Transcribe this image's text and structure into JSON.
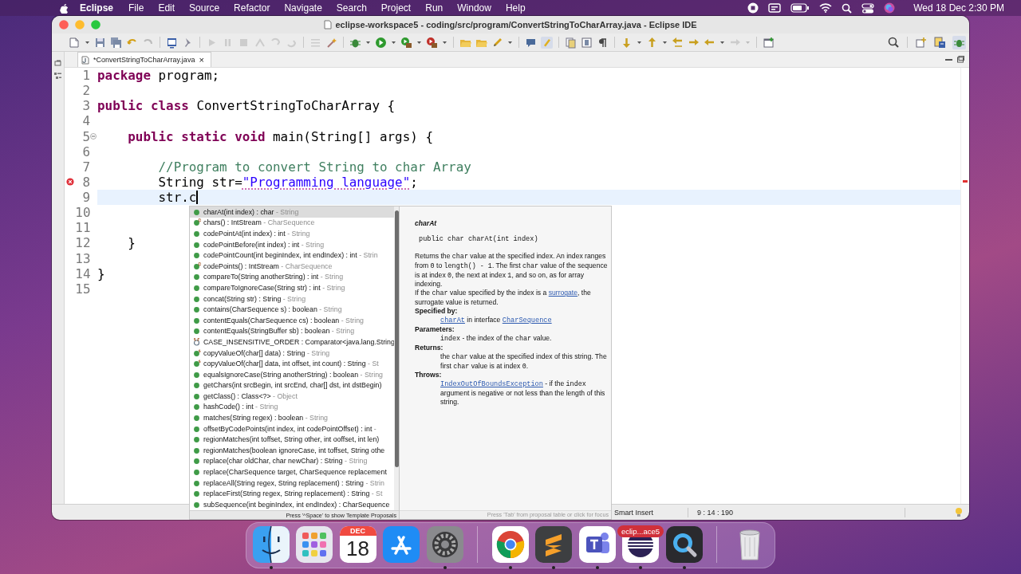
{
  "menubar": {
    "app": "Eclipse",
    "items": [
      "File",
      "Edit",
      "Source",
      "Refactor",
      "Navigate",
      "Search",
      "Project",
      "Run",
      "Window",
      "Help"
    ],
    "clock": "Wed 18 Dec  2:30 PM"
  },
  "window": {
    "title": "eclipse-workspace5 - coding/src/program/ConvertStringToCharArray.java - Eclipse IDE"
  },
  "editor_tab": {
    "label": "*ConvertStringToCharArray.java",
    "close": "×"
  },
  "code_lines": [
    {
      "number": "1",
      "current": false,
      "error": false,
      "foldable": false,
      "tokens": [
        {
          "kind": "keyword",
          "text": "package"
        },
        {
          "kind": "plain",
          "text": " program;"
        }
      ]
    },
    {
      "number": "2",
      "current": false,
      "error": false,
      "foldable": false
    },
    {
      "number": "3",
      "current": false,
      "error": false,
      "foldable": false,
      "tokens": [
        {
          "kind": "keyword",
          "text": "public class"
        },
        {
          "kind": "plain",
          "text": " ConvertStringToCharArray {"
        }
      ]
    },
    {
      "number": "4",
      "current": false,
      "error": false,
      "foldable": false
    },
    {
      "number": "5",
      "current": false,
      "error": false,
      "foldable": true,
      "tokens": [
        {
          "kind": "keyword",
          "text": "    public static void"
        },
        {
          "kind": "plain",
          "text": " main(String[] args) {"
        }
      ]
    },
    {
      "number": "6",
      "current": false,
      "error": false,
      "foldable": false
    },
    {
      "number": "7",
      "current": false,
      "error": false,
      "foldable": false,
      "tokens": [
        {
          "kind": "comment",
          "text": "        //Program to convert String to char Array"
        }
      ]
    },
    {
      "number": "8",
      "current": false,
      "error": true,
      "foldable": false,
      "tokens": [
        {
          "kind": "plain",
          "text": "        String str="
        },
        {
          "kind": "flagged-string",
          "text": "\"Programming language\""
        },
        {
          "kind": "plain",
          "text": ";"
        }
      ]
    },
    {
      "number": "9",
      "current": true,
      "error": false,
      "foldable": false,
      "tokens": [
        {
          "kind": "plain",
          "text": "        str.c"
        }
      ]
    },
    {
      "number": "10",
      "current": false,
      "error": false,
      "foldable": false
    },
    {
      "number": "11",
      "current": false,
      "error": false,
      "foldable": false
    },
    {
      "number": "12",
      "current": false,
      "error": false,
      "foldable": false,
      "tokens": [
        {
          "kind": "plain",
          "text": "    }"
        }
      ]
    },
    {
      "number": "13",
      "current": false,
      "error": false,
      "foldable": false
    },
    {
      "number": "14",
      "current": false,
      "error": false,
      "foldable": false,
      "tokens": [
        {
          "kind": "plain",
          "text": "}"
        }
      ]
    },
    {
      "number": "15",
      "current": false,
      "error": false,
      "foldable": false
    }
  ],
  "proposals": [
    {
      "kind": "method",
      "selected": true,
      "text": "charAt(int index) : char",
      "qualifier": "- String"
    },
    {
      "kind": "default-method",
      "selected": false,
      "text": "chars() : IntStream",
      "qualifier": "- CharSequence"
    },
    {
      "kind": "method",
      "selected": false,
      "text": "codePointAt(int index) : int",
      "qualifier": "- String"
    },
    {
      "kind": "method",
      "selected": false,
      "text": "codePointBefore(int index) : int",
      "qualifier": "- String"
    },
    {
      "kind": "method",
      "selected": false,
      "text": "codePointCount(int beginIndex, int endIndex) : int",
      "qualifier": "- Strin"
    },
    {
      "kind": "default-method",
      "selected": false,
      "text": "codePoints() : IntStream",
      "qualifier": "- CharSequence"
    },
    {
      "kind": "method",
      "selected": false,
      "text": "compareTo(String anotherString) : int",
      "qualifier": "- String"
    },
    {
      "kind": "method",
      "selected": false,
      "text": "compareToIgnoreCase(String str) : int",
      "qualifier": "- String"
    },
    {
      "kind": "method",
      "selected": false,
      "text": "concat(String str) : String",
      "qualifier": "- String"
    },
    {
      "kind": "method",
      "selected": false,
      "text": "contains(CharSequence s) : boolean",
      "qualifier": "- String"
    },
    {
      "kind": "method",
      "selected": false,
      "text": "contentEquals(CharSequence cs) : boolean",
      "qualifier": "- String"
    },
    {
      "kind": "method",
      "selected": false,
      "text": "contentEquals(StringBuffer sb) : boolean",
      "qualifier": "- String"
    },
    {
      "kind": "static-field",
      "selected": false,
      "text": "CASE_INSENSITIVE_ORDER : Comparator<java.lang.String"
    },
    {
      "kind": "static-method",
      "selected": false,
      "text": "copyValueOf(char[] data) : String",
      "qualifier": "- String"
    },
    {
      "kind": "static-method",
      "selected": false,
      "text": "copyValueOf(char[] data, int offset, int count) : String",
      "qualifier": "- St"
    },
    {
      "kind": "method",
      "selected": false,
      "text": "equalsIgnoreCase(String anotherString) : boolean",
      "qualifier": "- String"
    },
    {
      "kind": "method",
      "selected": false,
      "text": "getChars(int srcBegin, int srcEnd, char[] dst, int dstBegin)"
    },
    {
      "kind": "method",
      "selected": false,
      "text": "getClass() : Class<?>",
      "qualifier": "- Object"
    },
    {
      "kind": "method",
      "selected": false,
      "text": "hashCode() : int",
      "qualifier": "- String"
    },
    {
      "kind": "method",
      "selected": false,
      "text": "matches(String regex) : boolean",
      "qualifier": "- String"
    },
    {
      "kind": "method",
      "selected": false,
      "text": "offsetByCodePoints(int index, int codePointOffset) : int",
      "qualifier": "-"
    },
    {
      "kind": "method",
      "selected": false,
      "text": "regionMatches(int toffset, String other, int ooffset, int len)"
    },
    {
      "kind": "method",
      "selected": false,
      "text": "regionMatches(boolean ignoreCase, int toffset, String othe"
    },
    {
      "kind": "method",
      "selected": false,
      "text": "replace(char oldChar, char newChar) : String",
      "qualifier": "- String"
    },
    {
      "kind": "method",
      "selected": false,
      "text": "replace(CharSequence target, CharSequence replacement"
    },
    {
      "kind": "method",
      "selected": false,
      "text": "replaceAll(String regex, String replacement) : String",
      "qualifier": "- Strin"
    },
    {
      "kind": "method",
      "selected": false,
      "text": "replaceFirst(String regex, String replacement) : String",
      "qualifier": "- St"
    },
    {
      "kind": "method",
      "selected": false,
      "text": "subSequence(int beginIndex, int endIndex) : CharSequence"
    }
  ],
  "proposals_hint": "Press '^Space' to show Template Proposals",
  "doc": {
    "title": "charAt",
    "signature": "public char charAt(int index)",
    "paragraphs": [
      [
        {
          "kind": "text",
          "text": "Returns the "
        },
        {
          "kind": "code",
          "text": "char"
        },
        {
          "kind": "text",
          "text": " value at the specified index. An index ranges from "
        },
        {
          "kind": "code",
          "text": "0"
        },
        {
          "kind": "text",
          "text": " to "
        },
        {
          "kind": "code",
          "text": "length() - 1"
        },
        {
          "kind": "text",
          "text": ". The first "
        },
        {
          "kind": "code",
          "text": "char"
        },
        {
          "kind": "text",
          "text": " value of the sequence is at index "
        },
        {
          "kind": "code",
          "text": "0"
        },
        {
          "kind": "text",
          "text": ", the next at index "
        },
        {
          "kind": "code",
          "text": "1"
        },
        {
          "kind": "text",
          "text": ", and so on, as for array indexing."
        }
      ],
      [
        {
          "kind": "text",
          "text": "If the "
        },
        {
          "kind": "code",
          "text": "char"
        },
        {
          "kind": "text",
          "text": " value specified by the index is a "
        },
        {
          "kind": "link",
          "text": "surrogate"
        },
        {
          "kind": "text",
          "text": ", the surrogate value is returned."
        }
      ]
    ],
    "sections": [
      {
        "heading": "Specified by:",
        "body": [
          {
            "kind": "code-link",
            "text": "charAt"
          },
          {
            "kind": "text",
            "text": " in interface "
          },
          {
            "kind": "code-link",
            "text": "CharSequence"
          }
        ]
      },
      {
        "heading": "Parameters:",
        "body": [
          {
            "kind": "code",
            "text": "index"
          },
          {
            "kind": "text",
            "text": " - the index of the "
          },
          {
            "kind": "code",
            "text": "char"
          },
          {
            "kind": "text",
            "text": " value."
          }
        ]
      },
      {
        "heading": "Returns:",
        "body": [
          {
            "kind": "text",
            "text": "the "
          },
          {
            "kind": "code",
            "text": "char"
          },
          {
            "kind": "text",
            "text": " value at the specified index of this string. The first "
          },
          {
            "kind": "code",
            "text": "char"
          },
          {
            "kind": "text",
            "text": " value is at index "
          },
          {
            "kind": "code",
            "text": "0"
          },
          {
            "kind": "text",
            "text": "."
          }
        ]
      },
      {
        "heading": "Throws:",
        "body": [
          {
            "kind": "code-link",
            "text": "IndexOutOfBoundsException"
          },
          {
            "kind": "text",
            "text": " - if the "
          },
          {
            "kind": "code",
            "text": "index"
          },
          {
            "kind": "text",
            "text": " argument is negative or not less than the length of this string."
          }
        ]
      }
    ],
    "hint": "Press 'Tab' from proposal table or click for focus"
  },
  "status_bar": {
    "insert_mode": "Smart Insert",
    "position": "9 : 14 : 190"
  },
  "dock": [
    {
      "kind": "finder",
      "running": true
    },
    {
      "kind": "launchpad",
      "running": false
    },
    {
      "kind": "calendar",
      "running": false,
      "month": "DEC",
      "day": "18"
    },
    {
      "kind": "app-store",
      "running": false
    },
    {
      "kind": "settings",
      "running": true
    },
    {
      "kind": "divider"
    },
    {
      "kind": "chrome",
      "running": true
    },
    {
      "kind": "sublime",
      "running": true
    },
    {
      "kind": "teams",
      "running": true
    },
    {
      "kind": "eclipse",
      "running": true,
      "tooltip": "eclip...ace5"
    },
    {
      "kind": "quicktime",
      "running": true
    },
    {
      "kind": "divider"
    },
    {
      "kind": "trash",
      "running": false
    }
  ]
}
